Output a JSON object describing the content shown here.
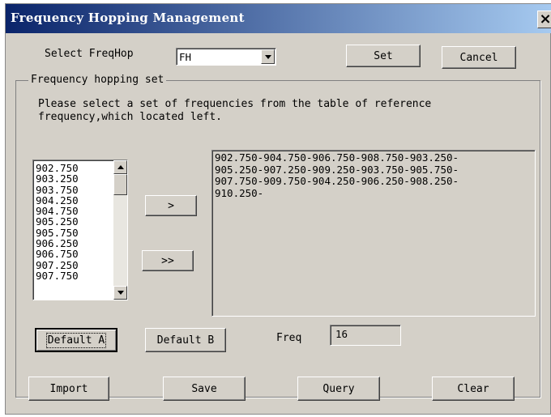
{
  "window": {
    "title": "Frequency Hopping Management",
    "close_label": "×"
  },
  "header": {
    "select_label": "Select FreqHop",
    "select_value": "FH",
    "set_label": "Set",
    "cancel_label": "Cancel"
  },
  "group": {
    "label": "Frequency hopping set",
    "instruction_line1": "Please select a set of frequencies from the table of reference",
    "instruction_line2": "frequency,which located left."
  },
  "reference_list": [
    "902.750",
    "903.250",
    "903.750",
    "904.250",
    "904.750",
    "905.250",
    "905.750",
    "906.250",
    "906.750",
    "907.250",
    "907.750"
  ],
  "selected_text": {
    "line1": "902.750-904.750-906.750-908.750-903.250-",
    "line2": "905.250-907.250-909.250-903.750-905.750-",
    "line3": "907.750-909.750-904.250-906.250-908.250-",
    "line4": "910.250-"
  },
  "buttons": {
    "add_one": ">",
    "add_all": ">>",
    "default_a": "Default A",
    "default_b": "Default B",
    "import": "Import",
    "save": "Save",
    "query": "Query",
    "clear": "Clear"
  },
  "freq": {
    "label": "Freq",
    "value": "16"
  }
}
